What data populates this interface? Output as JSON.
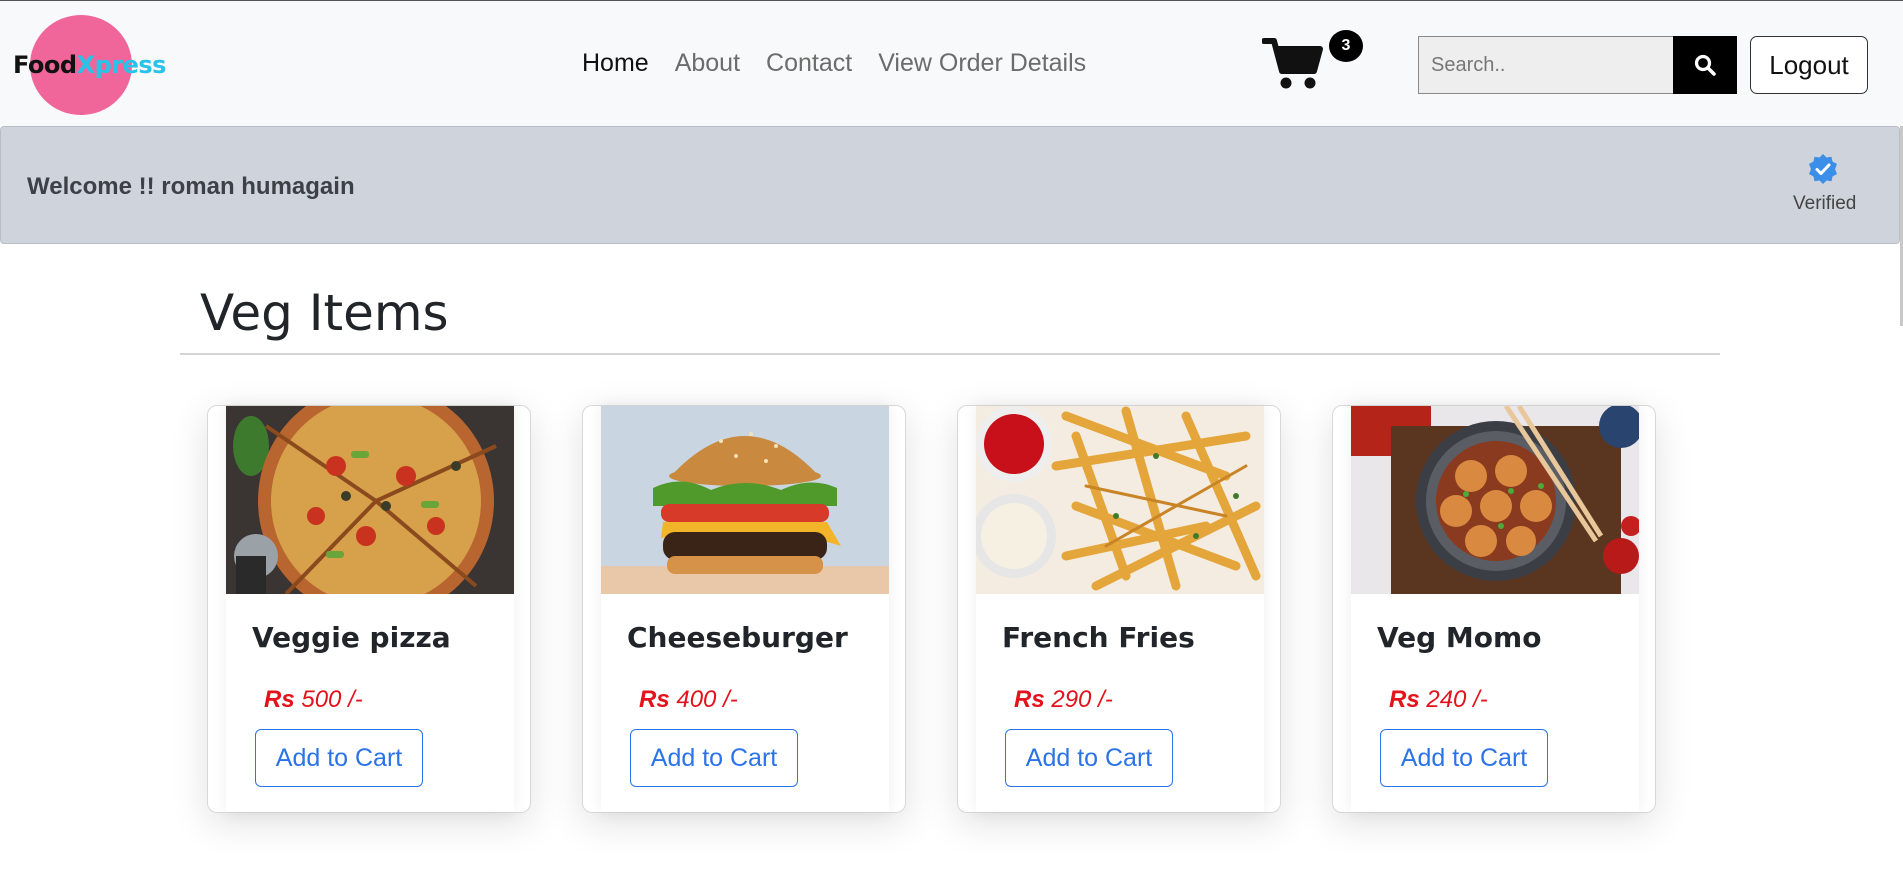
{
  "brand": {
    "part1": "Food",
    "part2": "Xpress"
  },
  "nav": {
    "links": [
      "Home",
      "About",
      "Contact",
      "View Order Details"
    ],
    "active_index": 0
  },
  "cart": {
    "count": "3",
    "icon": "shopping-cart-icon"
  },
  "search": {
    "placeholder": "Search..",
    "value": "",
    "icon": "search-icon"
  },
  "logout_label": "Logout",
  "welcome": {
    "text": "Welcome !! roman humagain",
    "verified_label": "Verified",
    "verified_icon": "verified-badge-icon",
    "verified_color": "#3b8fe8"
  },
  "section": {
    "title": "Veg Items"
  },
  "products": [
    {
      "name": "Veggie pizza",
      "currency": "Rs",
      "price": "500 /-",
      "button": "Add to Cart",
      "image": "veggie-pizza-image"
    },
    {
      "name": "Cheeseburger",
      "currency": "Rs",
      "price": "400 /-",
      "button": "Add to Cart",
      "image": "cheeseburger-image"
    },
    {
      "name": "French Fries",
      "currency": "Rs",
      "price": "290 /-",
      "button": "Add to Cart",
      "image": "french-fries-image"
    },
    {
      "name": "Veg Momo",
      "currency": "Rs",
      "price": "240 /-",
      "button": "Add to Cart",
      "image": "veg-momo-image"
    }
  ],
  "colors": {
    "logo_circle": "#f0669a",
    "logo_accent": "#27c3e8",
    "welcome_bg": "#cfd4dc",
    "price": "#e3121b",
    "button": "#2a73e8"
  }
}
